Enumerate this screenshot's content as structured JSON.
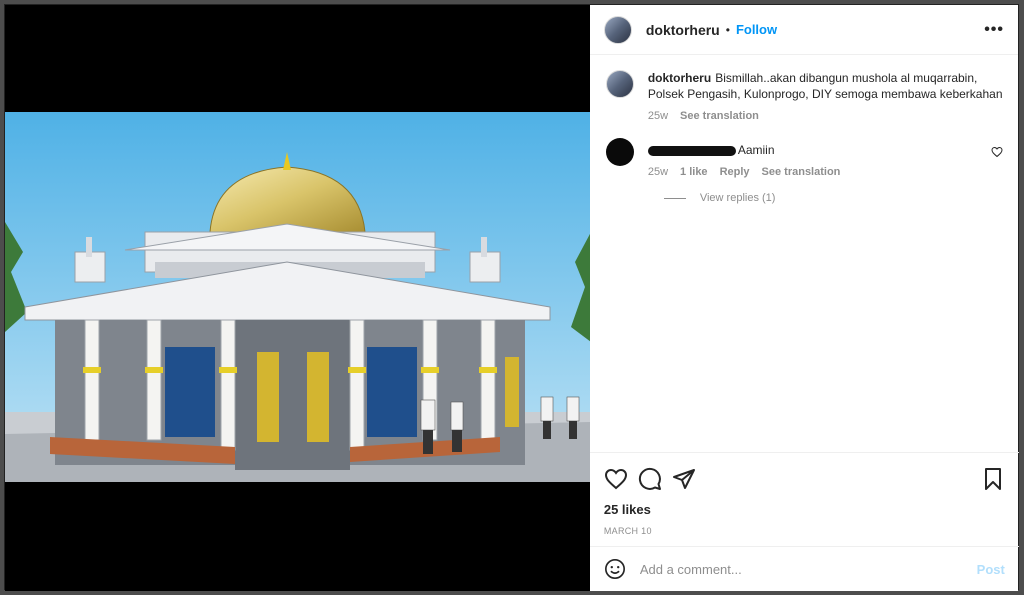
{
  "post": {
    "username": "doktorheru",
    "follow_label": "Follow",
    "more_icon": "more-options-icon"
  },
  "caption": {
    "username": "doktorheru",
    "text": "Bismillah..akan dibangun mushola al muqarrabin, Polsek Pengasih, Kulonprogo, DIY semoga membawa keberkahan",
    "time": "25w",
    "see_translation": "See translation"
  },
  "comment": {
    "text": "Aamiin",
    "time": "25w",
    "likes": "1 like",
    "reply": "Reply",
    "see_translation": "See translation",
    "view_replies": "View replies (1)"
  },
  "actions": {
    "likes": "25 likes",
    "date": "MARCH 10"
  },
  "add_comment": {
    "placeholder": "Add a comment...",
    "post_label": "Post"
  },
  "colors": {
    "accent": "#0095f6",
    "post_disabled": "#b2dffc",
    "muted": "#8e8e8e"
  }
}
